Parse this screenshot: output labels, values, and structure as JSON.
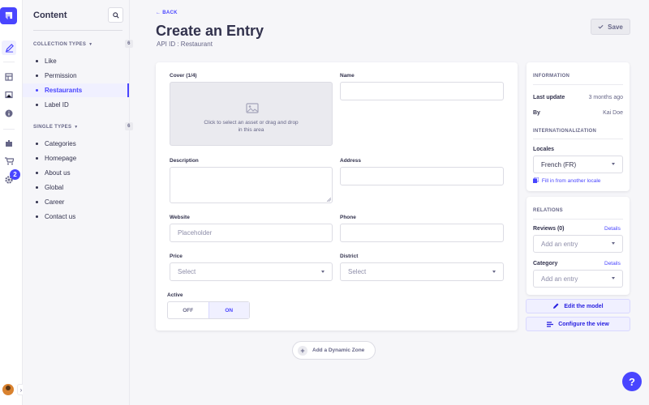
{
  "rail": {
    "notification_count": "2"
  },
  "nav": {
    "title": "Content",
    "collection_types": {
      "label": "COLLECTION TYPES",
      "count": "6",
      "items": [
        "Like",
        "Permission",
        "Restaurants",
        "Label ID"
      ],
      "active_index": 2
    },
    "single_types": {
      "label": "SINGLE TYPES",
      "count": "6",
      "items": [
        "Categories",
        "Homepage",
        "About us",
        "Global",
        "Career",
        "Contact us"
      ]
    }
  },
  "header": {
    "back": "BACK",
    "title": "Create an Entry",
    "subtitle": "API ID : Restaurant",
    "save": "Save"
  },
  "form": {
    "cover": {
      "label": "Cover (1/4)",
      "hint_line1": "Click to select an asset or drag and drop",
      "hint_line2": "in this area"
    },
    "name": {
      "label": "Name",
      "value": ""
    },
    "description": {
      "label": "Description",
      "value": ""
    },
    "address": {
      "label": "Address",
      "value": ""
    },
    "website": {
      "label": "Website",
      "placeholder": "Placeholder"
    },
    "phone": {
      "label": "Phone",
      "value": ""
    },
    "price": {
      "label": "Price",
      "placeholder": "Select"
    },
    "district": {
      "label": "District",
      "placeholder": "Select"
    },
    "active": {
      "label": "Active",
      "off": "OFF",
      "on": "ON",
      "selected": "ON"
    }
  },
  "dynamic_zone": {
    "label": "Add a Dynamic Zone"
  },
  "sidebar": {
    "information": {
      "title": "INFORMATION",
      "last_update_label": "Last update",
      "last_update_value": "3 months ago",
      "by_label": "By",
      "by_value": "Kai Doe"
    },
    "i18n": {
      "title": "INTERNATIONALIZATION",
      "locales_label": "Locales",
      "locale_value": "French (FR)",
      "fill_link": "Fill in from another locale"
    },
    "relations": {
      "title": "RELATIONS",
      "reviews_label": "Reviews (0)",
      "reviews_details": "Details",
      "reviews_placeholder": "Add an entry",
      "category_label": "Category",
      "category_details": "Details",
      "category_placeholder": "Add an entry"
    },
    "edit_model": "Edit the model",
    "configure_view": "Configure the view"
  },
  "help": {
    "label": "?"
  },
  "colors": {
    "primary": "#4945ff",
    "primary_light": "#f0f0ff",
    "text": "#32324d",
    "muted": "#666687",
    "border": "#dcdce4"
  }
}
